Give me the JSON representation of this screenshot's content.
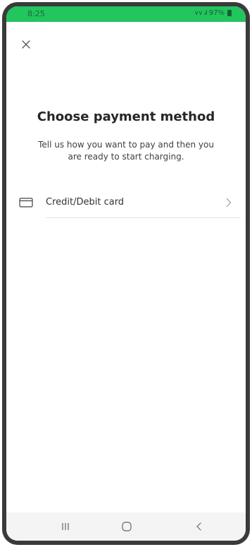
{
  "status_bar": {
    "time": "8:25",
    "signal": "∨∨ .ıl",
    "battery": "97%",
    "background_color": "#22c55e"
  },
  "header": {
    "close_icon": "close-icon"
  },
  "main": {
    "title": "Choose payment method",
    "subtitle": "Tell us how you want to pay and then you are ready to start charging."
  },
  "payment_methods": [
    {
      "label": "Credit/Debit card",
      "icon": "credit-card-icon",
      "action_icon": "chevron-right-icon"
    }
  ],
  "nav_bar": {
    "buttons": [
      "recents-icon",
      "home-icon",
      "back-icon"
    ]
  }
}
